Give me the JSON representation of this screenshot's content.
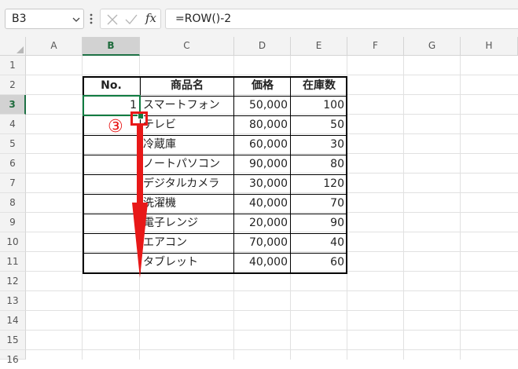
{
  "formula_bar": {
    "name_box": "B3",
    "formula": "=ROW()-2",
    "fx_label": "fx"
  },
  "columns": [
    "A",
    "B",
    "C",
    "D",
    "E",
    "F",
    "G",
    "H"
  ],
  "rows": [
    "1",
    "2",
    "3",
    "4",
    "5",
    "6",
    "7",
    "8",
    "9",
    "10",
    "11",
    "12",
    "13",
    "14",
    "15",
    "16"
  ],
  "table": {
    "headers": [
      "No.",
      "商品名",
      "価格",
      "在庫数"
    ],
    "rows": [
      {
        "no": "1",
        "name": "スマートフォン",
        "price": "50,000",
        "stock": "100"
      },
      {
        "no": "",
        "name": "テレビ",
        "price": "80,000",
        "stock": "50"
      },
      {
        "no": "",
        "name": "冷蔵庫",
        "price": "60,000",
        "stock": "30"
      },
      {
        "no": "",
        "name": "ノートパソコン",
        "price": "90,000",
        "stock": "80"
      },
      {
        "no": "",
        "name": "デジタルカメラ",
        "price": "30,000",
        "stock": "120"
      },
      {
        "no": "",
        "name": "洗濯機",
        "price": "40,000",
        "stock": "70"
      },
      {
        "no": "",
        "name": "電子レンジ",
        "price": "20,000",
        "stock": "90"
      },
      {
        "no": "",
        "name": "エアコン",
        "price": "70,000",
        "stock": "40"
      },
      {
        "no": "",
        "name": "タブレット",
        "price": "40,000",
        "stock": "60"
      }
    ]
  },
  "annotation": {
    "step_marker": "③",
    "color": "#e81818"
  },
  "selection_color": "#107c41"
}
